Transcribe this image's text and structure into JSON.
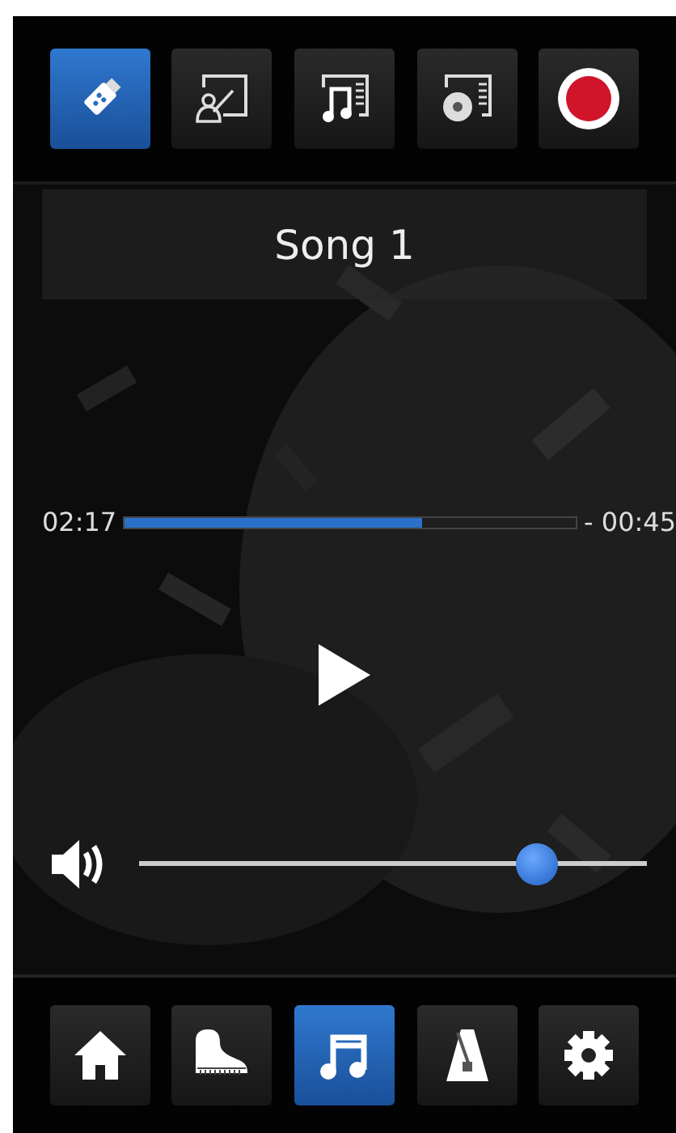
{
  "top_tabs": [
    {
      "kind": "usb",
      "selected": true
    },
    {
      "kind": "lesson",
      "selected": false
    },
    {
      "kind": "song-list",
      "selected": false
    },
    {
      "kind": "disc-list",
      "selected": false
    },
    {
      "kind": "record",
      "selected": false
    }
  ],
  "song_title": "Song 1",
  "progress": {
    "elapsed": "02:17",
    "remaining": "- 00:45",
    "level": 0.66
  },
  "volume": {
    "level": 0.81
  },
  "bottom_tabs": [
    {
      "kind": "home",
      "selected": false
    },
    {
      "kind": "piano",
      "selected": false
    },
    {
      "kind": "music",
      "selected": true
    },
    {
      "kind": "metronome",
      "selected": false
    },
    {
      "kind": "settings",
      "selected": false
    }
  ]
}
